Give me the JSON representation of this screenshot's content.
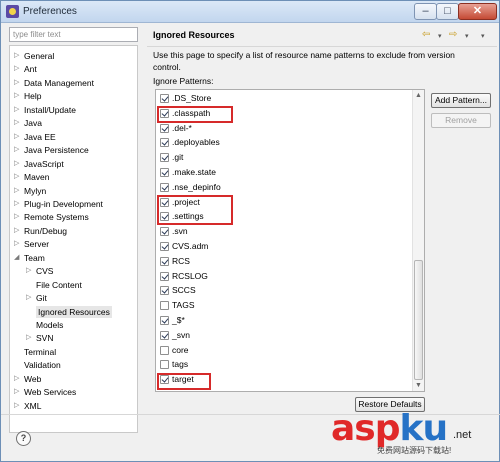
{
  "window": {
    "title": "Preferences",
    "buttons": {
      "minimize": "–",
      "maximize": "□",
      "close": "✕"
    }
  },
  "filter": {
    "placeholder": "type filter text"
  },
  "tree": [
    {
      "label": "General",
      "expandable": true
    },
    {
      "label": "Ant",
      "expandable": true
    },
    {
      "label": "Data Management",
      "expandable": true
    },
    {
      "label": "Help",
      "expandable": true
    },
    {
      "label": "Install/Update",
      "expandable": true
    },
    {
      "label": "Java",
      "expandable": true
    },
    {
      "label": "Java EE",
      "expandable": true
    },
    {
      "label": "Java Persistence",
      "expandable": true
    },
    {
      "label": "JavaScript",
      "expandable": true
    },
    {
      "label": "Maven",
      "expandable": true
    },
    {
      "label": "Mylyn",
      "expandable": true
    },
    {
      "label": "Plug-in Development",
      "expandable": true
    },
    {
      "label": "Remote Systems",
      "expandable": true
    },
    {
      "label": "Run/Debug",
      "expandable": true
    },
    {
      "label": "Server",
      "expandable": true
    },
    {
      "label": "Team",
      "expanded": true
    },
    {
      "label": "CVS",
      "expandable": true
    },
    {
      "label": "File Content"
    },
    {
      "label": "Git",
      "expandable": true
    },
    {
      "label": "Ignored Resources",
      "selected": true
    },
    {
      "label": "Models"
    },
    {
      "label": "SVN",
      "expandable": true
    },
    {
      "label": "Terminal"
    },
    {
      "label": "Validation"
    },
    {
      "label": "Web",
      "expandable": true
    },
    {
      "label": "Web Services",
      "expandable": true
    },
    {
      "label": "XML",
      "expandable": true
    }
  ],
  "page": {
    "heading": "Ignored Resources",
    "description": "Use this page to specify a list of resource name patterns to exclude from version control.",
    "ignore_label": "Ignore Patterns:",
    "nav": {
      "back": "⇦",
      "forward": "⇨",
      "menu": "▾"
    }
  },
  "patterns": [
    {
      "text": ".DS_Store",
      "checked": true
    },
    {
      "text": ".classpath",
      "checked": true
    },
    {
      "text": ".del-*",
      "checked": true
    },
    {
      "text": ".deployables",
      "checked": true
    },
    {
      "text": ".git",
      "checked": true
    },
    {
      "text": ".make.state",
      "checked": true
    },
    {
      "text": ".nse_depinfo",
      "checked": true
    },
    {
      "text": ".project",
      "checked": true
    },
    {
      "text": ".settings",
      "checked": true
    },
    {
      "text": ".svn",
      "checked": true
    },
    {
      "text": "CVS.adm",
      "checked": true
    },
    {
      "text": "RCS",
      "checked": true
    },
    {
      "text": "RCSLOG",
      "checked": true
    },
    {
      "text": "SCCS",
      "checked": true
    },
    {
      "text": "TAGS",
      "checked": false
    },
    {
      "text": "_$*",
      "checked": true
    },
    {
      "text": "_svn",
      "checked": true
    },
    {
      "text": "core",
      "checked": false
    },
    {
      "text": "tags",
      "checked": false
    },
    {
      "text": "target",
      "checked": true
    }
  ],
  "buttons": {
    "add_pattern": "Add Pattern...",
    "remove": "Remove",
    "restore_defaults": "Restore Defaults",
    "help": "?"
  },
  "watermark": {
    "brand_red": "asp",
    "brand_blue": "ku",
    "suffix": ".net",
    "subtitle": "免费网站源码下载站!"
  },
  "colors": {
    "highlight": "#d62a2a",
    "selection": "#e6e6e6"
  }
}
